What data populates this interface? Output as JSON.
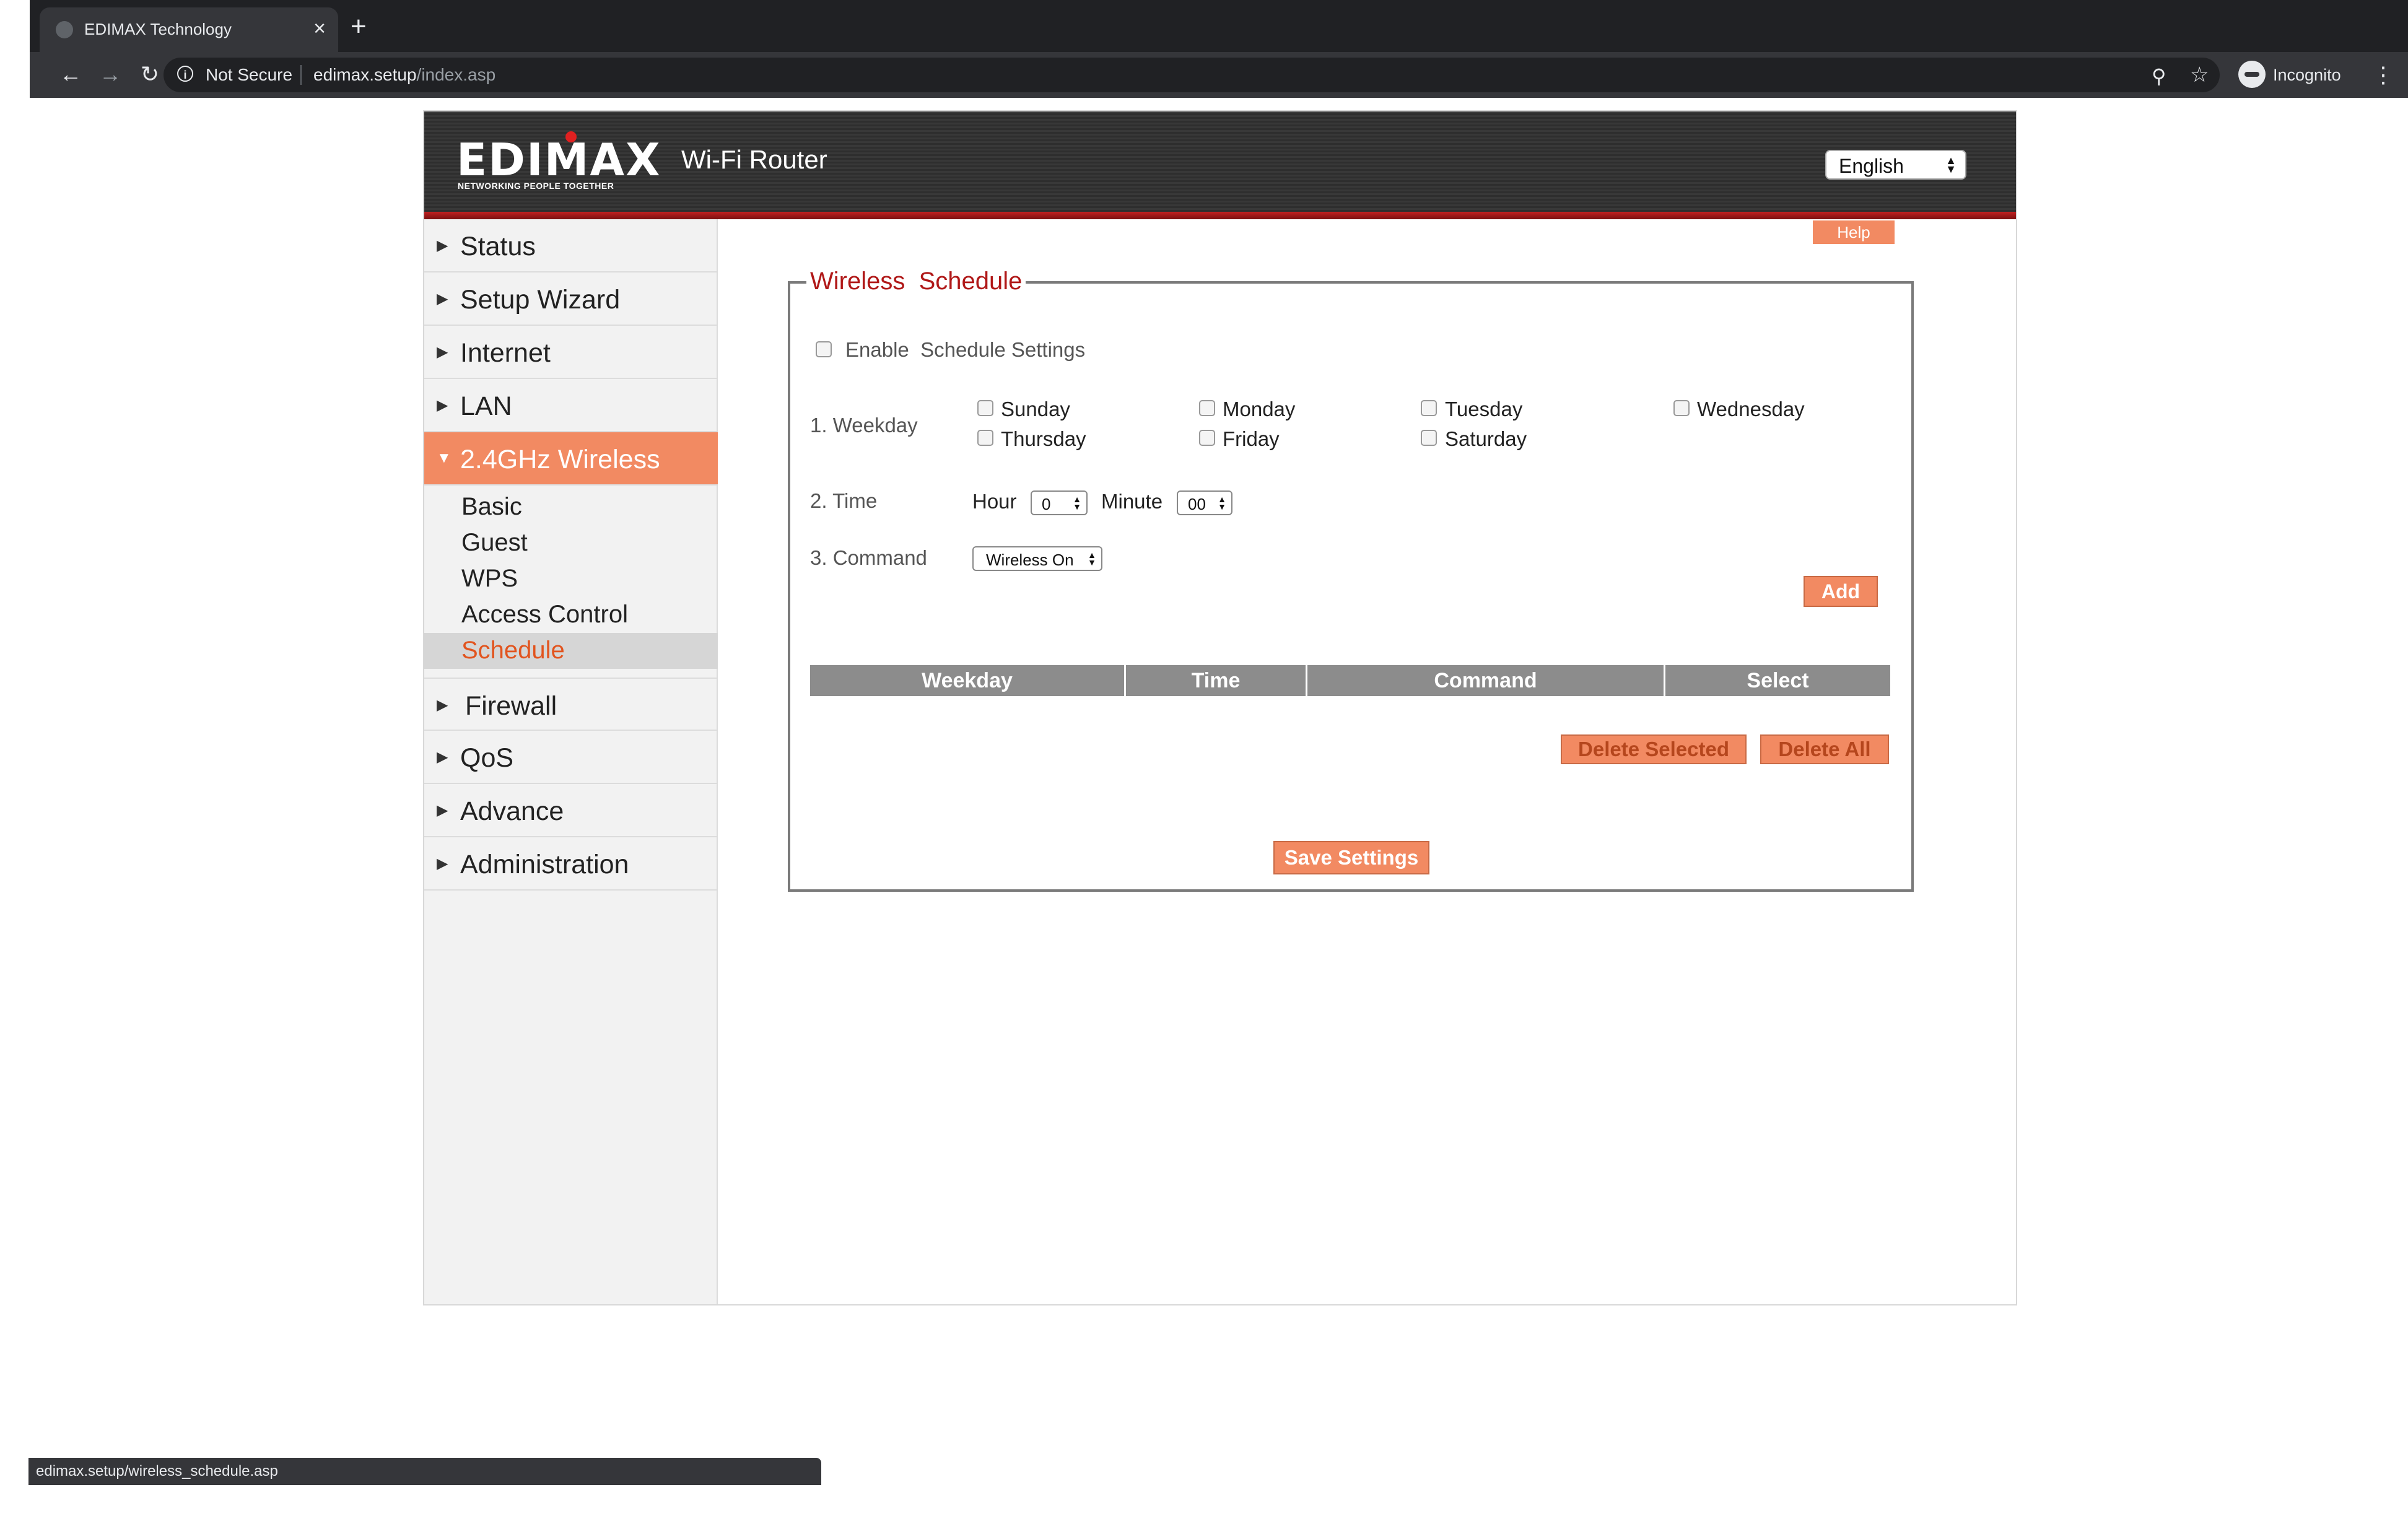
{
  "browser": {
    "tab_title": "EDIMAX Technology",
    "tab_close": "×",
    "new_tab": "+",
    "not_secure": "Not Secure",
    "url_host": "edimax.setup",
    "url_path": "/index.asp",
    "profile_label": "Incognito",
    "status_url": "edimax.setup/wireless_schedule.asp"
  },
  "header": {
    "logo_text": "EDIMAX",
    "logo_tagline": "NETWORKING PEOPLE TOGETHER",
    "product": "Wi-Fi Router",
    "language": "English"
  },
  "sidebar": {
    "items": [
      {
        "label": "Status"
      },
      {
        "label": "Setup Wizard"
      },
      {
        "label": "Internet"
      },
      {
        "label": "LAN"
      },
      {
        "label": "2.4GHz Wireless"
      },
      {
        "label": "Firewall"
      },
      {
        "label": "QoS"
      },
      {
        "label": "Advance"
      },
      {
        "label": "Administration"
      }
    ],
    "subitems": [
      {
        "label": "Basic"
      },
      {
        "label": "Guest"
      },
      {
        "label": "WPS"
      },
      {
        "label": "Access Control"
      },
      {
        "label": "Schedule"
      }
    ]
  },
  "main": {
    "help": "Help",
    "legend": "Wireless  Schedule",
    "enable_label": "Enable  Schedule Settings",
    "weekday_label": "1. Weekday",
    "days": [
      "Sunday",
      "Monday",
      "Tuesday",
      "Wednesday",
      "Thursday",
      "Friday",
      "Saturday"
    ],
    "time_label": "2. Time",
    "hour_label": "Hour",
    "hour_value": "0",
    "minute_label": "Minute",
    "minute_value": "00",
    "command_label": "3. Command",
    "command_value": "Wireless On",
    "add": "Add",
    "table_headers": [
      "Weekday",
      "Time",
      "Command",
      "Select"
    ],
    "delete_selected": "Delete Selected",
    "delete_all": "Delete All",
    "save": "Save Settings"
  },
  "colors": {
    "accent": "#f28a62",
    "legend_red": "#b01818",
    "active_sub_text": "#e2541e"
  }
}
